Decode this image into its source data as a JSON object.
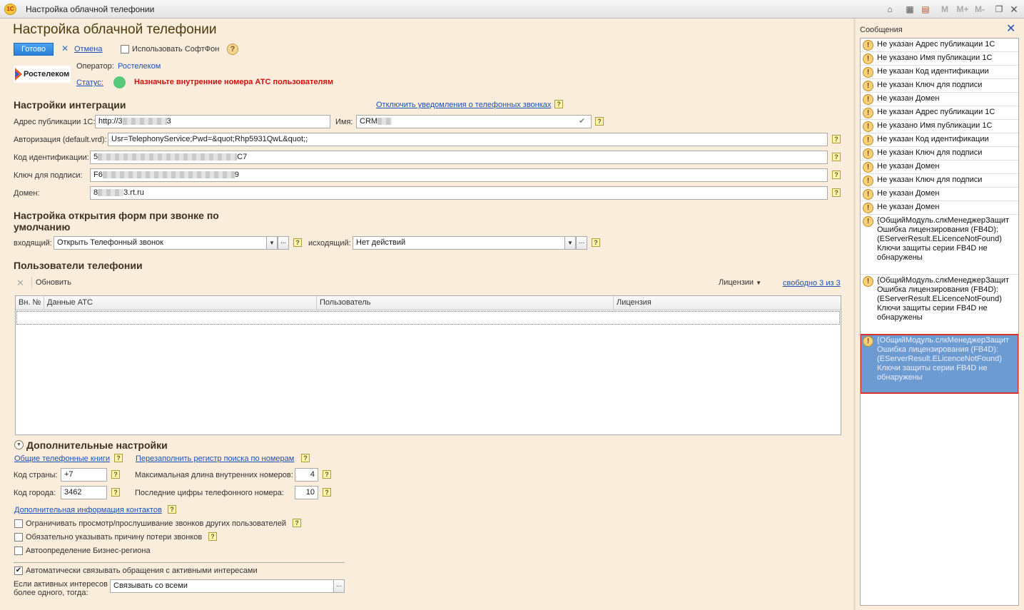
{
  "window": {
    "title": "Настройка облачной телефонии",
    "app_logo": "1С",
    "toolbar_icons": [
      "home-icon",
      "calculator-icon",
      "calendar-icon"
    ],
    "memory_buttons": [
      "M",
      "M+",
      "M-"
    ]
  },
  "form": {
    "title": "Настройка облачной телефонии",
    "actions": {
      "done": "Готово",
      "cancel": "Отмена",
      "softphone": "Использовать СофтФон"
    },
    "operator_logo_text": "Ростелеком",
    "operator_label": "Оператор:",
    "operator_value": "Ростелеком",
    "status_label": "Статус:",
    "status_color": "#57c97a",
    "status_message": "Назначьте внутренние номера АТС пользователям",
    "integration": {
      "heading": "Настройки интеграции",
      "disable_notifications_link": "Отключить уведомления о телефонных звонках",
      "publish_address_label": "Адрес публикации 1С:",
      "publish_address_value_prefix": "http://3",
      "publish_address_value_suffix": "3",
      "name_label": "Имя:",
      "name_value_prefix": "CRM",
      "auth_label": "Авторизация (default.vrd):",
      "auth_value": "Usr=TelephonyService;Pwd=&quot;Rhp5931QwL&quot;;",
      "id_code_label": "Код идентификации:",
      "id_code_prefix": "5",
      "id_code_suffix": "C7",
      "sign_key_label": "Ключ для подписи:",
      "sign_key_prefix": "F6",
      "sign_key_suffix": "9",
      "domain_label": "Домен:",
      "domain_prefix": "8",
      "domain_suffix": "3.rt.ru"
    },
    "call_forms": {
      "heading_line1": "Настройка открытия форм при звонке по",
      "heading_line2": "умолчанию",
      "incoming_label": "входящий:",
      "incoming_value": "Открыть Телефонный звонок",
      "outgoing_label": "исходящий:",
      "outgoing_value": "Нет действий"
    },
    "users": {
      "heading": "Пользователи телефонии",
      "refresh": "Обновить",
      "licenses": "Лицензии",
      "free_link": "свободно 3 из 3",
      "columns": [
        "Вн. №",
        "Данные АТС",
        "Пользователь",
        "Лицензия"
      ]
    },
    "extra": {
      "heading": "Дополнительные настройки",
      "phonebooks_link": "Общие телефонные книги",
      "refill_link": "Перезаполнить регистр поиска по номерам",
      "country_code_label": "Код страны:",
      "country_code_value": "+7",
      "city_code_label": "Код города:",
      "city_code_value": "3462",
      "max_len_label": "Максимальная длина внутренних номеров:",
      "max_len_value": "4",
      "last_digits_label": "Последние цифры телефонного номера:",
      "last_digits_value": "10",
      "contacts_info_link": "Дополнительная информация контактов",
      "restrict_label": "Ограничивать просмотр/прослушивание звонков других пользователей",
      "require_reason_label": "Обязательно указывать причину потери звонков",
      "auto_region_label": "Автоопределение Бизнес-региона",
      "auto_link_label": "Автоматически связывать обращения с активными интересами",
      "multi_interest_label_line1": "Если активных интересов",
      "multi_interest_label_line2": "более одного, тогда:",
      "multi_interest_value": "Связывать со всеми"
    }
  },
  "messages": {
    "title": "Сообщения",
    "items": [
      "Не указан Адрес публикации 1С",
      "Не указано Имя публикации 1С",
      "Не указан Код идентификации",
      "Не указан Ключ для подписи",
      "Не указан Домен",
      "Не указан Адрес публикации 1С",
      "Не указано Имя публикации 1С",
      "Не указан Код идентификации",
      "Не указан Ключ для подписи",
      "Не указан Домен",
      "Не указан Ключ для подписи",
      "Не указан Домен",
      "Не указан Домен"
    ],
    "long_items": [
      "{ОбщийМодуль.слкМенеджерЗащит Ошибка лицензирования (FB4D): (EServerResult.ELicenceNotFound) Ключи защиты серии FB4D не обнаружены",
      "{ОбщийМодуль.слкМенеджерЗащит Ошибка лицензирования (FB4D): (EServerResult.ELicenceNotFound) Ключи защиты серии FB4D не обнаружены",
      "{ОбщийМодуль.слкМенеджерЗащит Ошибка лицензирования (FB4D): (EServerResult.ELicenceNotFound) Ключи защиты серии FB4D не обнаружены"
    ]
  }
}
